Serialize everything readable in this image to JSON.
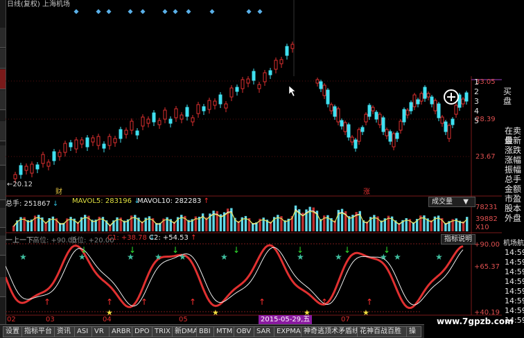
{
  "header": {
    "title": "日线(复权) 上海机场"
  },
  "price_axis": {
    "p1": "33.05",
    "p2": "28.39",
    "p3": "23.67"
  },
  "low_label": "←20.12",
  "marker_cai": "财",
  "marker_zhang": "涨",
  "volume_info": {
    "total_label": "总手: 251867",
    "mavol5_label": "MAVOL5: 283196",
    "mavol10_label": "MAVOL10: 282283",
    "panel_name": "成交量",
    "axis_top": "78231",
    "axis_mid": "39882",
    "axis_unit": "X10"
  },
  "indicator_info": {
    "name": "一上一下",
    "high_label": "高位: +90.00",
    "low_label": "低位: +20.00",
    "c1_label": "C1: +38.78",
    "c2_label": "C2: +54.53",
    "help_button": "指标说明",
    "axis_top": "+90.00",
    "axis_mid": "+65.37",
    "axis_low": "+40.19"
  },
  "right_panel": {
    "buy_items": [
      "1",
      "2",
      "3",
      "4",
      "5"
    ],
    "buy_label": "买\n盘",
    "fields": [
      "在卖盘",
      "最新",
      "涨跌",
      "涨幅",
      "振幅",
      "总手",
      "金额",
      "市盈",
      "股本",
      "外盘"
    ],
    "airport_label": "机场航",
    "times": [
      "14:59",
      "14:59",
      "14:59",
      "14:59",
      "14:59",
      "14:59",
      "14:59",
      "14:59"
    ]
  },
  "x_axis": {
    "labels": [
      "02",
      "03",
      "04",
      "05",
      "06",
      "07"
    ],
    "selected_date": "2015-05-29,五"
  },
  "bottom_tabs": [
    "设置",
    "指标平台",
    "资讯",
    "ASI",
    "VR",
    "ARBR",
    "DPO",
    "TRIX",
    "新DMA",
    "BBI",
    "MTM",
    "OBV",
    "SAR",
    "EXPMA",
    "神奇逃顶术矛盾线",
    "花神百战百胜",
    "操"
  ],
  "watermark": "www.7gpzb.com",
  "colors": {
    "up": "#e03030",
    "down": "#40e0f0",
    "volume_up": "#c03030",
    "volume_down": "#60d8e8",
    "signal_line": "#e03030",
    "white_line": "#f0f0f0",
    "star": "#f0e040",
    "green_arrow": "#30e030",
    "red_arrow": "#ff3030"
  }
}
